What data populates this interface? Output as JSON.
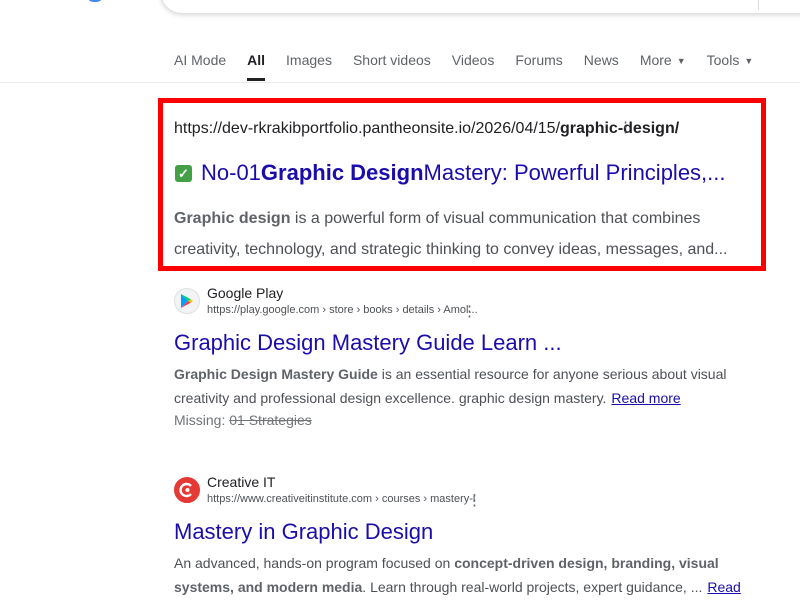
{
  "tabs": [
    {
      "label": "AI Mode"
    },
    {
      "label": "All"
    },
    {
      "label": "Images"
    },
    {
      "label": "Short videos"
    },
    {
      "label": "Videos"
    },
    {
      "label": "Forums"
    },
    {
      "label": "News"
    },
    {
      "label": "More"
    },
    {
      "label": "Tools"
    }
  ],
  "results": [
    {
      "url_prefix": "https://dev-rkrakibportfolio.pantheonsite.io/2026/04/15/",
      "url_bold": "graphic-design/",
      "title_prefix": "No-01 ",
      "title_bold": "Graphic Design",
      "title_rest": " Mastery: Powerful Principles,...",
      "snippet_bold": "Graphic design",
      "snippet_rest": " is a powerful form of visual communication that combines creativity, technology, and strategic thinking to convey ideas, messages, and...",
      "icon": "check-mark-icon",
      "icon_color": "#43a047"
    },
    {
      "site_name": "Google Play",
      "breadcrumb": "https://play.google.com › store › books › details › Amol...",
      "title": "Graphic Design Mastery Guide Learn ...",
      "snippet_bold": "Graphic Design Mastery Guide",
      "snippet_rest": " is an essential resource for anyone serious about visual creativity and professional design excellence. graphic design mastery.",
      "read_more": "Read more",
      "missing_label": "Missing:",
      "missing_terms": "01 Strategies",
      "icon": "google-play-icon"
    },
    {
      "site_name": "Creative IT",
      "breadcrumb": "https://www.creativeitinstitute.com › courses › mastery-i",
      "title": "Mastery in Graphic Design",
      "snippet_lead": "An advanced, hands-on program focused on ",
      "snippet_bold": "concept-driven design, branding, visual systems, and modern media",
      "snippet_rest": ". Learn through real-world projects, expert guidance, ...",
      "read_more": "Read more",
      "icon": "creative-it-logo-icon",
      "icon_color": "#e53935"
    }
  ],
  "colors": {
    "link": "#1a0dab",
    "highlight_border": "#ff0000",
    "text": "#202124",
    "snippet": "#4d5156"
  },
  "icons": {
    "menu": "more-vert-icon",
    "dropdown": "caret-down-icon"
  }
}
